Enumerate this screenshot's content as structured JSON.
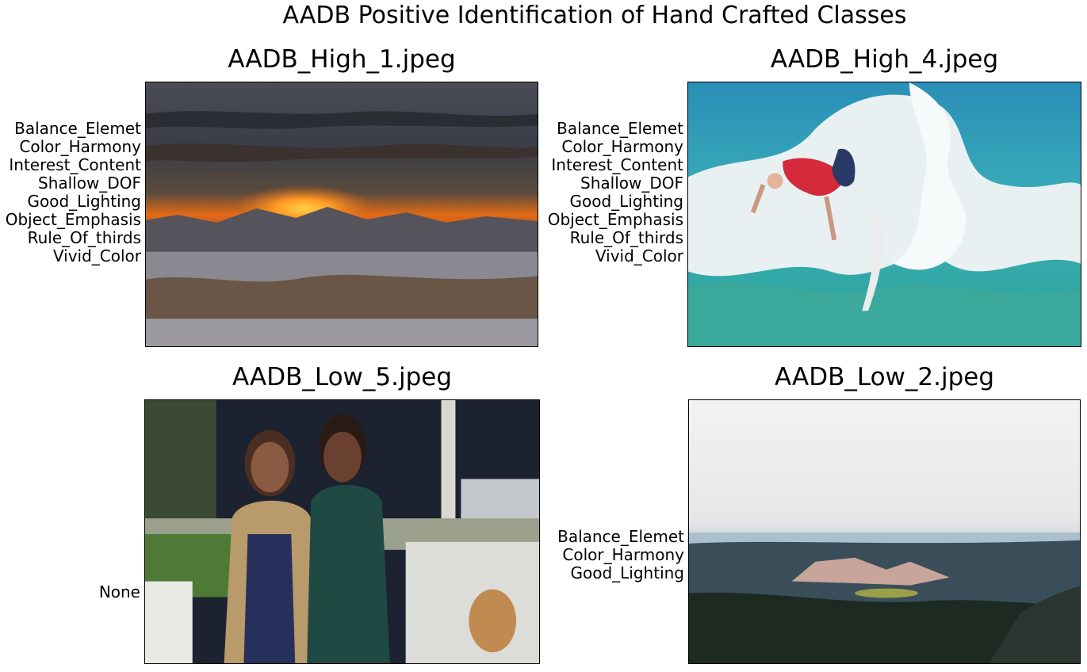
{
  "figure": {
    "title": "AADB Positive Identification of Hand Crafted Classes"
  },
  "panels": [
    {
      "title": "AADB_High_1.jpeg",
      "labels": [
        "Balance_Elemet",
        "Color_Harmony",
        "Interest_Content",
        "Shallow_DOF",
        "Good_Lighting",
        "Object_Emphasis",
        "Rule_Of_thirds",
        "Vivid_Color"
      ]
    },
    {
      "title": "AADB_High_4.jpeg",
      "labels": [
        "Balance_Elemet",
        "Color_Harmony",
        "Interest_Content",
        "Shallow_DOF",
        "Good_Lighting",
        "Object_Emphasis",
        "Rule_Of_thirds",
        "Vivid_Color"
      ]
    },
    {
      "title": "AADB_Low_5.jpeg",
      "labels": [
        "None"
      ]
    },
    {
      "title": "AADB_Low_2.jpeg",
      "labels": [
        "Balance_Elemet",
        "Color_Harmony",
        "Good_Lighting"
      ]
    }
  ]
}
